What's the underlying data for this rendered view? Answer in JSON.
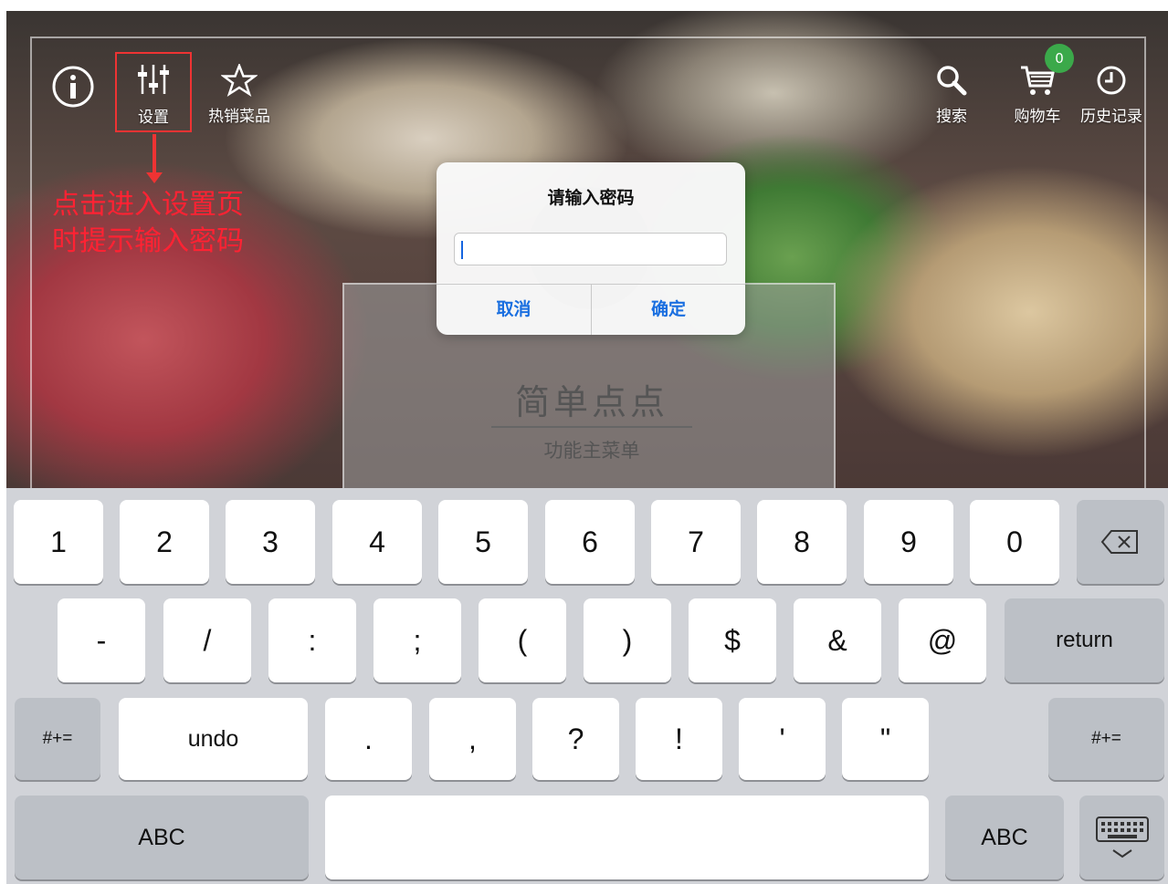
{
  "topbar": {
    "info_icon": "info-circle-icon",
    "settings_label": "设置",
    "hot_label": "热销菜品",
    "search_label": "搜索",
    "cart_label": "购物车",
    "cart_count": "0",
    "history_label": "历史记录"
  },
  "annotation": {
    "line1": "点击进入设置页",
    "line2": "时提示输入密码",
    "color": "#ee2222"
  },
  "brand": {
    "title": "简单点点",
    "subtitle": "功能主菜单"
  },
  "dialog": {
    "title": "请输入密码",
    "input_value": "",
    "cancel_label": "取消",
    "ok_label": "确定"
  },
  "keyboard": {
    "row1": [
      "1",
      "2",
      "3",
      "4",
      "5",
      "6",
      "7",
      "8",
      "9",
      "0"
    ],
    "row2": [
      "-",
      "/",
      ":",
      ";",
      "(",
      ")",
      "$",
      "&",
      "@"
    ],
    "return_label": "return",
    "row3_left": "#+=",
    "undo_label": "undo",
    "row3": [
      ".",
      ",",
      "?",
      "!",
      "'",
      "\""
    ],
    "row3_right": "#+=",
    "abc_left": "ABC",
    "abc_right": "ABC",
    "backspace_icon": "backspace-icon",
    "dismiss_icon": "keyboard-dismiss-icon"
  },
  "colors": {
    "accent_blue": "#1a6fe0",
    "badge_green": "#3ba94a",
    "highlight_red": "#ee3333"
  }
}
